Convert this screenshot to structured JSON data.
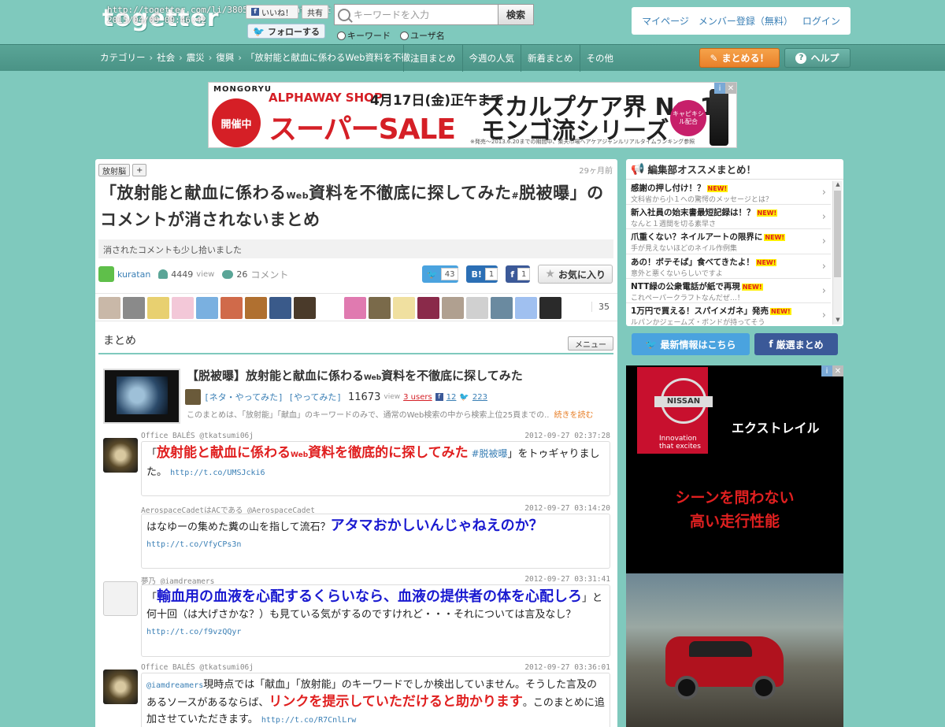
{
  "header": {
    "logo_text": "togetter",
    "url_overlay": "http://togetter.com/li/380574?no_location=t",
    "timestamp_overlay": "2015/04/09 09:46:42",
    "mini_buttons": [
      "f",
      "いいね！",
      "共有"
    ],
    "follow_label": "フォローする",
    "search_placeholder": "キーワードを入力",
    "search_button": "検索",
    "radio_keyword": "キーワード",
    "radio_user": "ユーザ名",
    "account_links": [
      "マイページ",
      "メンバー登録（無料）",
      "ログイン"
    ]
  },
  "nav": {
    "breadcrumb": [
      "カテゴリー",
      "社会",
      "震災",
      "復興",
      "「放射能と献血に係わるWeb資料を不徹…"
    ],
    "links": [
      "注目まとめ",
      "今週の人気",
      "新着まとめ",
      "その他"
    ],
    "matome_button": "まとめる！",
    "help_button": "ヘルプ"
  },
  "banner": {
    "brand": "MONGORYU",
    "kaisai": "開催中",
    "shop": "ALPHAWAY SHOP",
    "date": "4月17日(金)正午まで",
    "sale": "スーパーSALE",
    "right1": "スカルプケア界 No.1",
    "right2": "モンゴ流シリーズ",
    "badge": "キャピキシル配合",
    "fine": "※発売～2013.6.20までの期間中、楽天市場ヘアケアジャンルリアルタイムランキング参照"
  },
  "article": {
    "tag": "放射脳",
    "tag_add": "+",
    "ago": "29ヶ月前",
    "title_a": "「放射能と献血に係わる",
    "title_web": "Web",
    "title_b": "資料を不徹底に探してみた",
    "title_hash": "#",
    "title_c": "脱被曝」のコメントが消されないまとめ",
    "description": "消されたコメントも少し拾いました",
    "author": "kuratan",
    "views": "4449",
    "view_label": "view",
    "comments": "26",
    "comment_label": "コメント",
    "share_tw": "43",
    "share_hb": "1",
    "share_fb": "1",
    "share_hb_icon": "B!",
    "share_fb_icon": "f",
    "fav_label": "お気に入り",
    "fav_count": "35",
    "section_label": "まとめ",
    "menu_label": "メニュー"
  },
  "card": {
    "title_a": "【脱被曝】放射能と献血に係わる",
    "title_web": "Web",
    "title_b": "資料を不徹底に探してみた",
    "tags": "[ネタ・やってみた] [やってみた]",
    "views": "11673",
    "view_label": "view",
    "users": "3 users",
    "fb_count": "12",
    "tw_count": "223",
    "desc": "このまとめは、「放射能」「献血」のキーワードのみで、通常のWeb検索の中から検索上位25頁までの..",
    "more": "続きを読む"
  },
  "tweets": [
    {
      "name": "Office BALÉS @tkatsumi06j",
      "time": "2012-09-27 02:37:28",
      "pre": "「",
      "red": "放射能と献血に係わる",
      "web": "Web",
      "red2": "資料を徹底的に探してみた",
      "hash": " #脱被曝",
      "post": "」をトゥギャりました。",
      "link": "http://t.co/UMSJcki6"
    },
    {
      "name": "AerospaceCadetはACである @AerospaceCadet",
      "time": "2012-09-27 03:14:20",
      "pre": "はなゆーの集めた糞の山を指して流石？",
      "blue": "アタマおかしいんじゃねえのか？",
      "link": "http://t.co/VfyCPs3n"
    },
    {
      "name": "夢乃 @iamdreamers",
      "time": "2012-09-27 03:31:41",
      "pre": "「",
      "blue": "輸血用の血液を心配するくらいなら、血液の提供者の体を心配しろ",
      "post": "」と何十回（は大げさかな？）も見ている気がするのですけれど・・・それについては言及なし？",
      "link": "http://t.co/f9vzQQyr"
    },
    {
      "name": "Office BALÉS @tkatsumi06j",
      "time": "2012-09-27 03:36:01",
      "mention": "@iamdreamers",
      "pre": "現時点では「献血」「放射能」のキーワードでしか検出していません。そうした言及のあるソースがあるならば、",
      "red": "リンクを提示していただけると助かります",
      "post": "。このまとめに追加させていただきます。",
      "link": "http://t.co/R7CnlLrw"
    }
  ],
  "sidebar": {
    "reco_title": "編集部オススメまとめ！",
    "new_label": "NEW!",
    "items": [
      {
        "title": "感謝の押し付け！？",
        "sub": "文科省から小１への驚愕のメッセージとは？"
      },
      {
        "title": "新入社員の始末書最短記録は！？",
        "sub": "なんと１週間を切る素早さ"
      },
      {
        "title": "爪重くない？ネイルアートの限界に",
        "sub": "手が見えないほどのネイル作例集"
      },
      {
        "title": "あの！ボテそば」食べてきたよ！",
        "sub": "意外と悪くないらしいですよ"
      },
      {
        "title": "NTT緑の公衆電話が紙で再現",
        "sub": "これペーパークラフトなんだぜ…！"
      },
      {
        "title": "1万円で買える！スパイメガネ」発売",
        "sub": "ルパンかジェームズ・ボンドが持ってそう"
      }
    ],
    "tw_button": "最新情報はこちら",
    "fb_button": "厳選まとめ"
  },
  "side_ad": {
    "brand": "NISSAN",
    "inno1": "Innovation",
    "inno2": "that excites",
    "model": "エクストレイル",
    "tag1": "シーンを問わない",
    "tag2": "高い走行性能"
  }
}
